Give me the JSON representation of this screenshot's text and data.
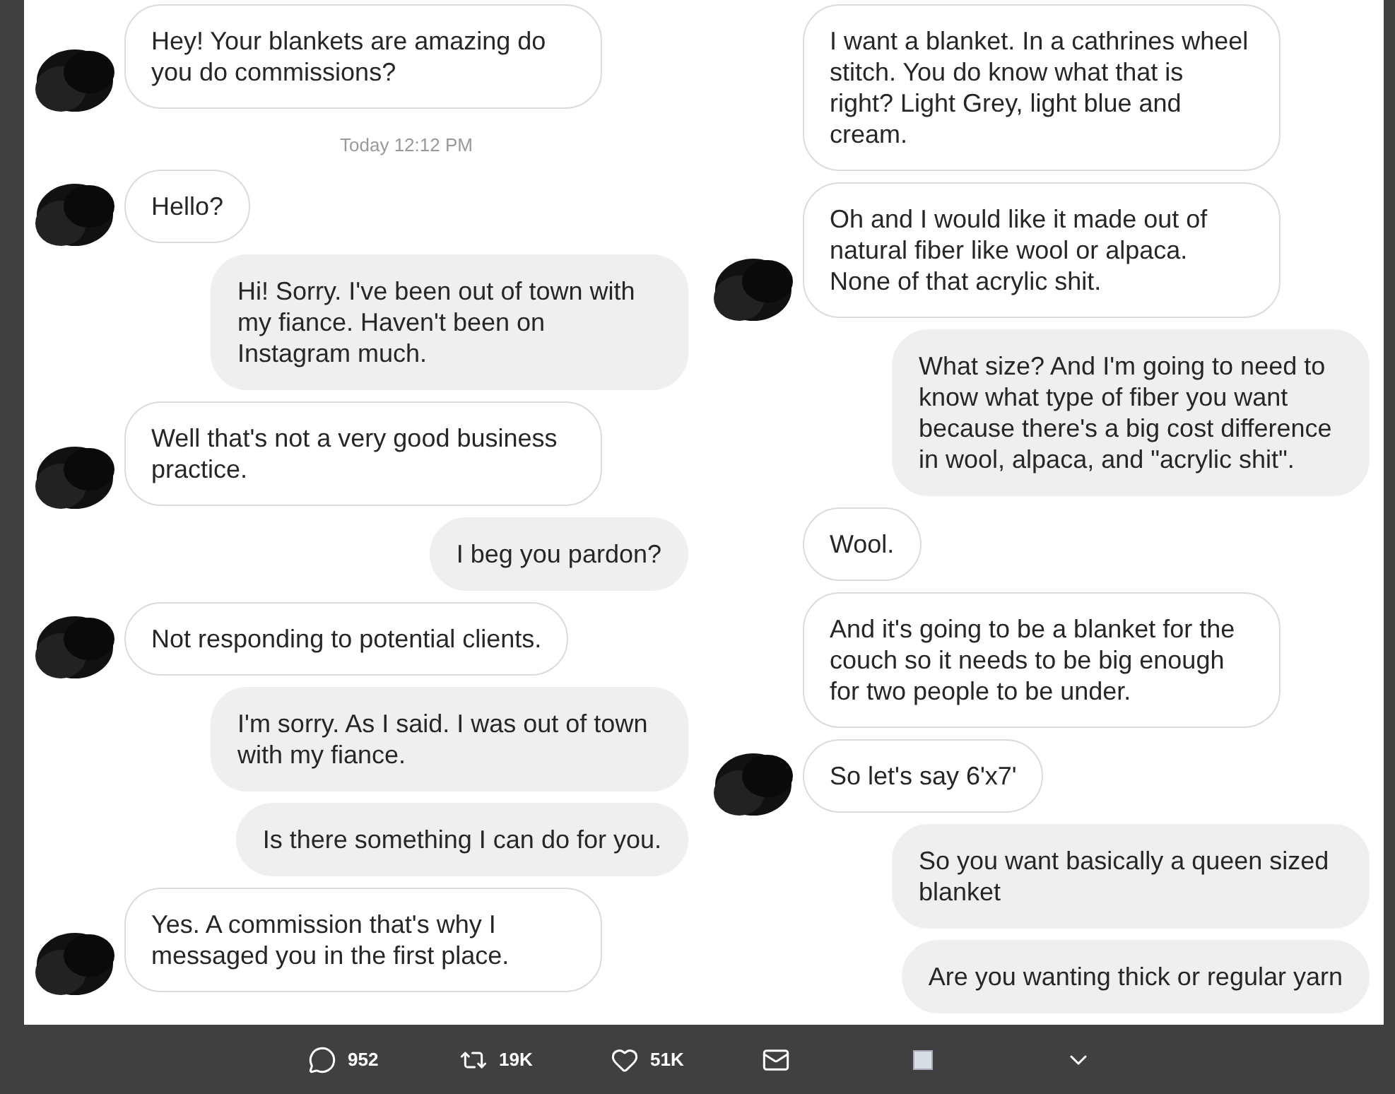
{
  "columns": [
    {
      "messages": [
        {
          "kind": "received",
          "text": "Hey! Your blankets are amazing do you do commissions?",
          "redacted_avatar": true
        },
        {
          "kind": "timestamp",
          "text": "Today 12:12 PM"
        },
        {
          "kind": "received",
          "text": "Hello?",
          "redacted_avatar": true
        },
        {
          "kind": "sent",
          "text": "Hi! Sorry. I've been out of town with my fiance. Haven't been on Instagram much."
        },
        {
          "kind": "received",
          "text": "Well that's not a very good business practice.",
          "redacted_avatar": true
        },
        {
          "kind": "sent",
          "text": "I beg you pardon?"
        },
        {
          "kind": "received",
          "text": "Not responding to potential clients.",
          "redacted_avatar": true
        },
        {
          "kind": "sent",
          "text": "I'm sorry. As I said. I was out of town with my fiance."
        },
        {
          "kind": "sent",
          "text": "Is there something I can do for you."
        },
        {
          "kind": "received",
          "text": "Yes. A commission that's why I messaged you in the first place.",
          "redacted_avatar": true
        }
      ]
    },
    {
      "messages": [
        {
          "kind": "received",
          "text": "I want a blanket. In a cathrines wheel stitch. You do know what that is right? Light Grey, light blue and cream.",
          "redacted_avatar": false
        },
        {
          "kind": "received",
          "text": "Oh and I would like it made out of natural fiber like wool or alpaca. None of that acrylic shit.",
          "redacted_avatar": true
        },
        {
          "kind": "sent",
          "text": "What size? And I'm going to need to know what type of fiber you want because there's a big cost difference in wool, alpaca, and \"acrylic shit\"."
        },
        {
          "kind": "received",
          "text": "Wool.",
          "redacted_avatar": false
        },
        {
          "kind": "received",
          "text": "And it's going to be a blanket for the couch so it needs to be big enough for two people to be under.",
          "redacted_avatar": false
        },
        {
          "kind": "received",
          "text": "So let's say 6'x7'",
          "redacted_avatar": true
        },
        {
          "kind": "sent",
          "text": "So you want basically a queen sized blanket"
        },
        {
          "kind": "sent",
          "text": "Are you wanting thick or regular yarn"
        }
      ]
    }
  ],
  "action_bar": [
    {
      "kind": "reply",
      "count": "952"
    },
    {
      "kind": "retweet",
      "count": "19K"
    },
    {
      "kind": "like",
      "count": "51K"
    },
    {
      "kind": "message"
    },
    {
      "kind": "thumbnail"
    },
    {
      "kind": "more"
    }
  ]
}
